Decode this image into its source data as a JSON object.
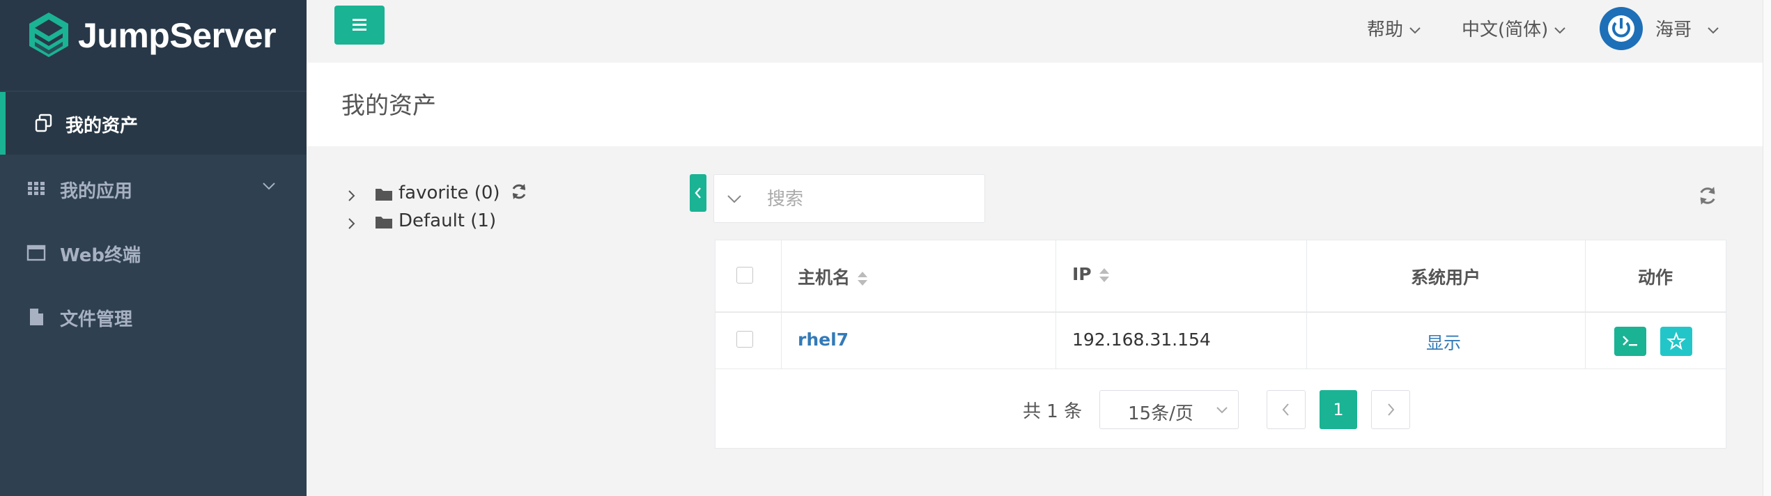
{
  "app": {
    "logo_text": "JumpServer"
  },
  "sidebar": {
    "items": [
      {
        "label": "我的资产",
        "icon": "assets-icon",
        "active": true
      },
      {
        "label": "我的应用",
        "icon": "grid-icon",
        "has_submenu": true
      },
      {
        "label": "Web终端",
        "icon": "terminal-window-icon"
      },
      {
        "label": "文件管理",
        "icon": "file-icon"
      }
    ]
  },
  "topbar": {
    "help_label": "帮助",
    "language_label": "中文(简体)",
    "user_name": "海哥"
  },
  "page": {
    "title": "我的资产"
  },
  "tree": {
    "nodes": [
      {
        "label": "favorite (0)"
      },
      {
        "label": "Default (1)"
      }
    ]
  },
  "search": {
    "placeholder": "搜索"
  },
  "table": {
    "columns": [
      "主机名",
      "IP",
      "系统用户",
      "动作"
    ],
    "rows": [
      {
        "hostname": "rhel7",
        "ip": "192.168.31.154",
        "system_user": "显示"
      }
    ]
  },
  "pagination": {
    "total_text": "共 1 条",
    "page_size": "15条/页",
    "current_page": "1"
  },
  "colors": {
    "accent": "#1ab394",
    "sidebar": "#2f4050",
    "link": "#337ab7",
    "favorite_button": "#23c6c8"
  }
}
